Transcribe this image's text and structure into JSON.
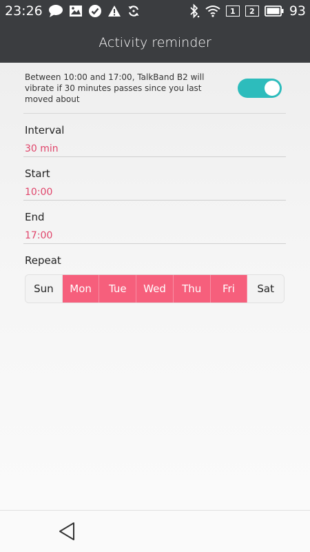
{
  "status_bar": {
    "time": "23:26",
    "left_icons": [
      "chat-bubble-icon",
      "image-icon",
      "check-circle-icon",
      "warning-icon",
      "sync-icon"
    ],
    "right_icons": [
      "bluetooth-icon",
      "wifi-icon"
    ],
    "sim1": "1",
    "sim2": "2",
    "battery_percent": "93"
  },
  "app_bar": {
    "title": "Activity reminder"
  },
  "reminder": {
    "description": "Between 10:00 and 17:00, TalkBand B2 will vibrate if 30 minutes passes since you last moved about",
    "enabled": true
  },
  "fields": [
    {
      "label": "Interval",
      "value": "30 min"
    },
    {
      "label": "Start",
      "value": "10:00"
    },
    {
      "label": "End",
      "value": "17:00"
    }
  ],
  "repeat": {
    "label": "Repeat",
    "days": [
      {
        "label": "Sun",
        "selected": false
      },
      {
        "label": "Mon",
        "selected": true
      },
      {
        "label": "Tue",
        "selected": true
      },
      {
        "label": "Wed",
        "selected": true
      },
      {
        "label": "Thu",
        "selected": true
      },
      {
        "label": "Fri",
        "selected": true
      },
      {
        "label": "Sat",
        "selected": false
      }
    ]
  },
  "colors": {
    "accent_pink": "#f65f7c",
    "toggle_teal": "#2dbcbc",
    "bar_dark": "#3b3d40"
  },
  "nav_bar": {
    "icons": [
      "back-triangle-icon"
    ]
  }
}
